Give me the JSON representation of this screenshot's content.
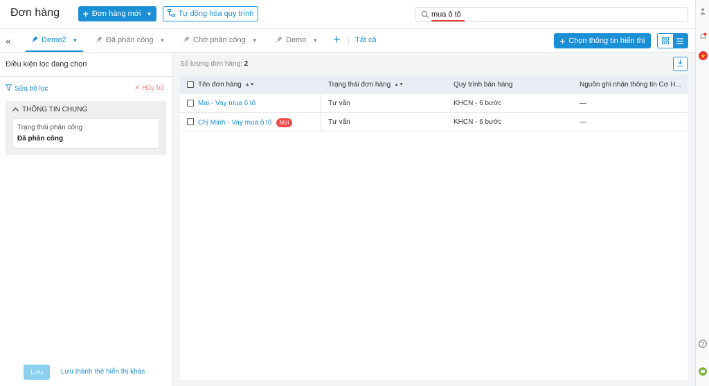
{
  "header": {
    "title": "Đơn hàng",
    "new_order_label": "Đơn hàng mới",
    "automation_label": "Tự động hóa quy trình",
    "search_value": "mua ô tô",
    "search_placeholder": ""
  },
  "tabs": {
    "items": [
      {
        "label": "Demo2",
        "active": true
      },
      {
        "label": "Đã phân công",
        "active": false
      },
      {
        "label": "Chờ phân công",
        "active": false
      },
      {
        "label": "Demo",
        "active": false
      }
    ],
    "all_label": "Tất cả",
    "choose_display_label": "Chọn thông tin hiển thị"
  },
  "filter_panel": {
    "title": "Điều kiện lọc đang chọn",
    "edit_label": "Sửa bộ lọc",
    "clear_label": "Hủy bỏ",
    "group_title": "THÔNG TIN CHUNG",
    "condition_label": "Trạng thái phân công",
    "condition_value": "Đã phân công",
    "save_label": "Lưu",
    "save_other_label": "Lưu thành thẻ hiển thị khác"
  },
  "main": {
    "count_label": "Số lượng đơn hàng:",
    "count_value": "2",
    "columns": [
      "Tên đơn hàng",
      "Trạng thái đơn hàng",
      "Quy trình bán hàng",
      "Nguồn ghi nhận thông tin Cơ H..."
    ],
    "rows": [
      {
        "name": "Mai - Vay mua ô tô",
        "status": "Tư vấn",
        "process": "KHCN - 6 bước",
        "source": "—",
        "badge": ""
      },
      {
        "name": "Chị Minh - Vay mua ô tô",
        "status": "Tư vấn",
        "process": "KHCN - 6 bước",
        "source": "—",
        "badge": "Mới"
      }
    ],
    "scroll_fraction": 0.37
  },
  "colors": {
    "accent": "#1a8fd6",
    "badge": "#f04848",
    "search_underline": "#e53935"
  }
}
